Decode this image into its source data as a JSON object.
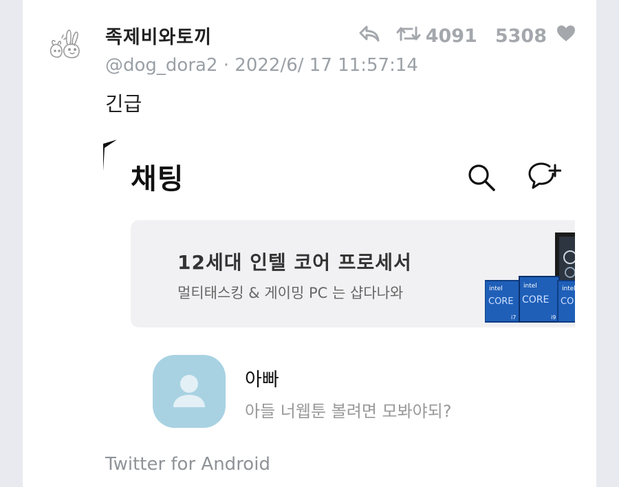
{
  "tweet": {
    "display_name": "족제비와토끼",
    "handle": "@dog_dora2",
    "separator": "·",
    "timestamp": "2022/6/ 17 11:57:14",
    "text": "긴급",
    "retweet_count": "4091",
    "like_count": "5308",
    "source": "Twitter for Android",
    "icons": {
      "reply": "reply-icon",
      "retweet": "retweet-icon",
      "like": "heart-icon",
      "avatar": "rabbit-avatar-icon"
    }
  },
  "screenshot": {
    "title": "채팅",
    "icons": {
      "search": "search-icon",
      "new_chat": "new-chat-icon"
    },
    "ad": {
      "title": "12세대 인텔 코어 프로세서",
      "subtitle": "멀티태스킹 & 게이밍 PC 는 샵다나와",
      "badges": [
        {
          "brand": "intel",
          "label": "CORE",
          "tier": "i7"
        },
        {
          "brand": "intel",
          "label": "CORE",
          "tier": "i9"
        },
        {
          "brand": "intel",
          "label": "CO",
          "tier": ""
        }
      ]
    },
    "chat": {
      "name": "아빠",
      "message": "아들 너웹툰 볼려면 모봐야되?"
    }
  },
  "colors": {
    "background": "#e9eaf0",
    "card": "#ffffff",
    "muted_text": "#9aa0a6",
    "contact_avatar": "#a8d2e2",
    "ad_background": "#f1f1f3",
    "intel_blue": "#1f5fb8"
  }
}
